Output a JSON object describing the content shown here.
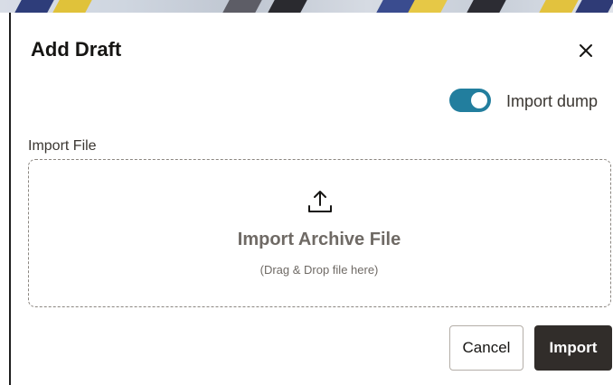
{
  "dialog": {
    "title": "Add Draft",
    "close_icon": "close-icon"
  },
  "toggle": {
    "label": "Import dump",
    "state": "on",
    "accent_color": "#227e9e"
  },
  "import_file": {
    "label": "Import File",
    "icon": "upload-icon",
    "title": "Import Archive File",
    "subtitle": "(Drag & Drop file here)"
  },
  "footer": {
    "cancel_label": "Cancel",
    "import_label": "Import",
    "import_color": "#312d2a"
  }
}
